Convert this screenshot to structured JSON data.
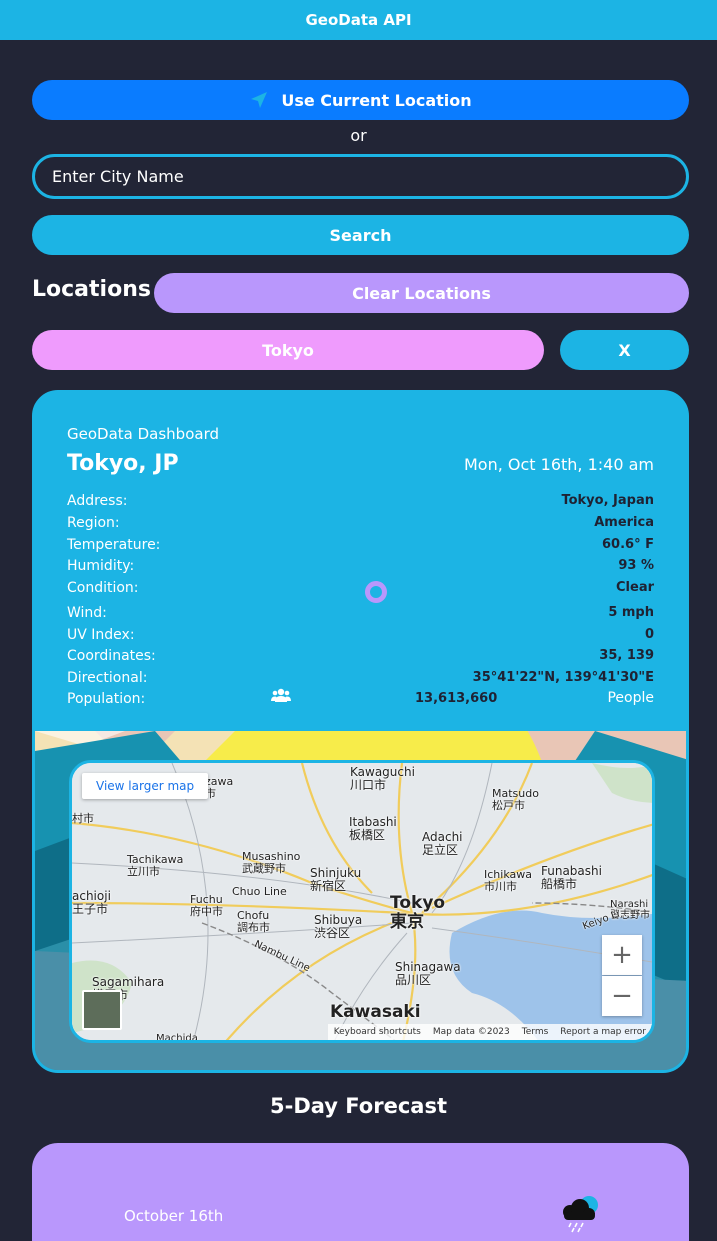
{
  "header": {
    "title": "GeoData API"
  },
  "search": {
    "current_location_label": "Use Current Location",
    "or_label": "or",
    "city_placeholder": "Enter City Name",
    "search_label": "Search"
  },
  "locations": {
    "title": "Locations",
    "clear_label": "Clear Locations",
    "items": [
      {
        "label": "Tokyo",
        "remove_label": "X"
      }
    ]
  },
  "dashboard": {
    "subtitle": "GeoData Dashboard",
    "city": "Tokyo, JP",
    "datetime": "Mon, Oct 16th, 1:40 am",
    "rows": [
      {
        "key": "Address:",
        "value": "Tokyo, Japan"
      },
      {
        "key": "Region:",
        "value": "America"
      },
      {
        "key": "Temperature:",
        "value": "60.6° F"
      },
      {
        "key": "Humidity:",
        "value": "93 %"
      },
      {
        "key": "Condition:",
        "value": "Clear"
      },
      {
        "key": "Wind:",
        "value": "5 mph"
      },
      {
        "key": "UV Index:",
        "value": "0"
      },
      {
        "key": "Coordinates:",
        "value": "35, 139"
      },
      {
        "key": "Directional:",
        "value": "35°41'22\"N, 139°41'30\"E"
      }
    ],
    "population": {
      "key": "Population:",
      "value": "13,613,660",
      "unit": "People"
    }
  },
  "map": {
    "view_larger_label": "View larger map",
    "zoom_in": "+",
    "zoom_out": "−",
    "footer": {
      "shortcuts": "Keyboard shortcuts",
      "data": "Map data ©2023",
      "terms": "Terms",
      "report": "Report a map error"
    },
    "labels": [
      {
        "text": "Kawaguchi\n川口市"
      },
      {
        "text": "Matsudo\n松戸市"
      },
      {
        "text": "Itabashi\n板橋区"
      },
      {
        "text": "Adachi\n足立区"
      },
      {
        "text": "Tachikawa\n立川市"
      },
      {
        "text": "Musashino\n武蔵野市"
      },
      {
        "text": "Shinjuku\n新宿区"
      },
      {
        "text": "Ichikawa\n市川市"
      },
      {
        "text": "Funabashi\n船橋市"
      },
      {
        "text": "achioji\n王子市"
      },
      {
        "text": "Chuo Line"
      },
      {
        "text": "Fuchu\n府中市"
      },
      {
        "text": "Tokyo\n東京"
      },
      {
        "text": "Chofu\n調布市"
      },
      {
        "text": "Shibuya\n渋谷区"
      },
      {
        "text": "Narashi\n習志野市"
      },
      {
        "text": "Shinagawa\n品川区"
      },
      {
        "text": "Sagamihara\n模原市"
      },
      {
        "text": "Kawasaki"
      },
      {
        "text": "Machida"
      },
      {
        "text": "rozawa\n沢市"
      },
      {
        "text": "村市"
      },
      {
        "text": "Nambu Line"
      },
      {
        "text": "Keiyo Li"
      }
    ]
  },
  "forecast": {
    "title": "5-Day Forecast",
    "days": [
      {
        "date": "October 16th",
        "icon": "rain-cloud-icon"
      }
    ]
  },
  "colors": {
    "accent": "#1cb4e4",
    "primary": "#0a7cff",
    "purple": "#b997fc",
    "pink": "#ef9bfd",
    "background": "#222536"
  }
}
